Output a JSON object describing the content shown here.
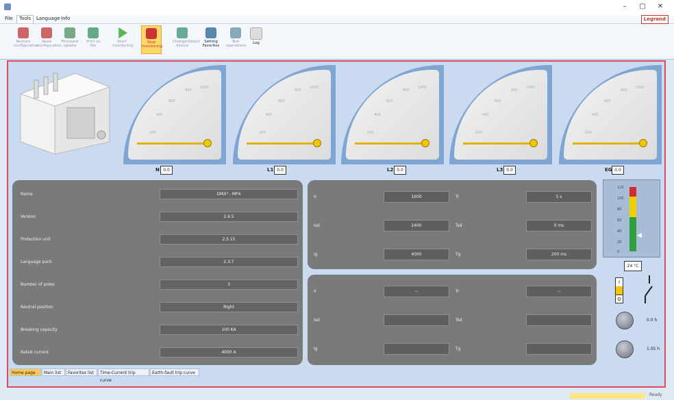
{
  "window": {
    "minimize": "–",
    "maximize": "▢",
    "close": "✕"
  },
  "menu": {
    "items": [
      "File",
      "Tools",
      "Language",
      "Info"
    ],
    "brand": "Legrand"
  },
  "ribbon": {
    "buttons": [
      {
        "label": "Restore configuration",
        "color": "#c66",
        "active": false,
        "bold": false
      },
      {
        "label": "Read configuration",
        "color": "#c66",
        "active": false,
        "bold": false
      },
      {
        "label": "Firmware update",
        "color": "#7a8",
        "active": false,
        "bold": false
      },
      {
        "label": "Print to file",
        "color": "#6a8",
        "active": false,
        "bold": false
      },
      {
        "label": "Start monitoring",
        "color": "#5b5",
        "active": false,
        "bold": false
      },
      {
        "label": "Stop monitoring",
        "color": "#c33",
        "active": true,
        "bold": false
      },
      {
        "label": "Change/Select device",
        "color": "#6a9",
        "active": false,
        "bold": false
      },
      {
        "label": "Setting Favorites",
        "color": "#58a",
        "active": false,
        "bold": true
      },
      {
        "label": "Test operations",
        "color": "#8ab",
        "active": false,
        "bold": false
      },
      {
        "label": "Log",
        "color": "#aaa",
        "active": false,
        "bold": true
      }
    ]
  },
  "gauges": [
    {
      "name": "N",
      "value": "0.0"
    },
    {
      "name": "L1",
      "value": "0.0"
    },
    {
      "name": "L2",
      "value": "0.0"
    },
    {
      "name": "L3",
      "value": "0.0"
    },
    {
      "name": "EG",
      "value": "0.0"
    }
  ],
  "gauge_scale": [
    "200",
    "400",
    "600",
    "800",
    "1000"
  ],
  "info": [
    {
      "label": "Name",
      "value": "DMX³ - MP4"
    },
    {
      "label": "Version",
      "value": "2.6.5"
    },
    {
      "label": "Protection unit",
      "value": "2.5.15"
    },
    {
      "label": "Language pack",
      "value": "2.3.7"
    },
    {
      "label": "Number of poles",
      "value": "3"
    },
    {
      "label": "Neutral position",
      "value": "Right"
    },
    {
      "label": "Breaking capacity",
      "value": "100 KA"
    },
    {
      "label": "Rated current",
      "value": "4000 A"
    }
  ],
  "settings_top": [
    {
      "l1": "Ir",
      "v1": "1600",
      "l2": "Tr",
      "v2": "5 s"
    },
    {
      "l1": "Isd",
      "v1": "2400",
      "l2": "Tsd",
      "v2": "0 ms"
    },
    {
      "l1": "Ig",
      "v1": "4000",
      "l2": "Tg",
      "v2": "200 ms"
    }
  ],
  "settings_bottom": [
    {
      "l1": "Ir",
      "v1": "--",
      "l2": "Tr",
      "v2": "--"
    },
    {
      "l1": "Isd",
      "v1": "",
      "l2": "Tsd",
      "v2": ""
    },
    {
      "l1": "Ig",
      "v1": "",
      "l2": "Tg",
      "v2": ""
    }
  ],
  "thermo": {
    "ticks": [
      "120",
      "100",
      "80",
      "60",
      "40",
      "20",
      "0"
    ],
    "temp": "24 °C",
    "pointer": "◀"
  },
  "switch": {
    "on": "I",
    "off": "O"
  },
  "lamps": [
    {
      "label": "0.0 h"
    },
    {
      "label": "1.05 h"
    }
  ],
  "tabs": [
    "Home page",
    "Main list",
    "Favorites list",
    "Time-Current trip curve",
    "Earth-fault trip curve"
  ],
  "status": {
    "text": "Ready"
  }
}
